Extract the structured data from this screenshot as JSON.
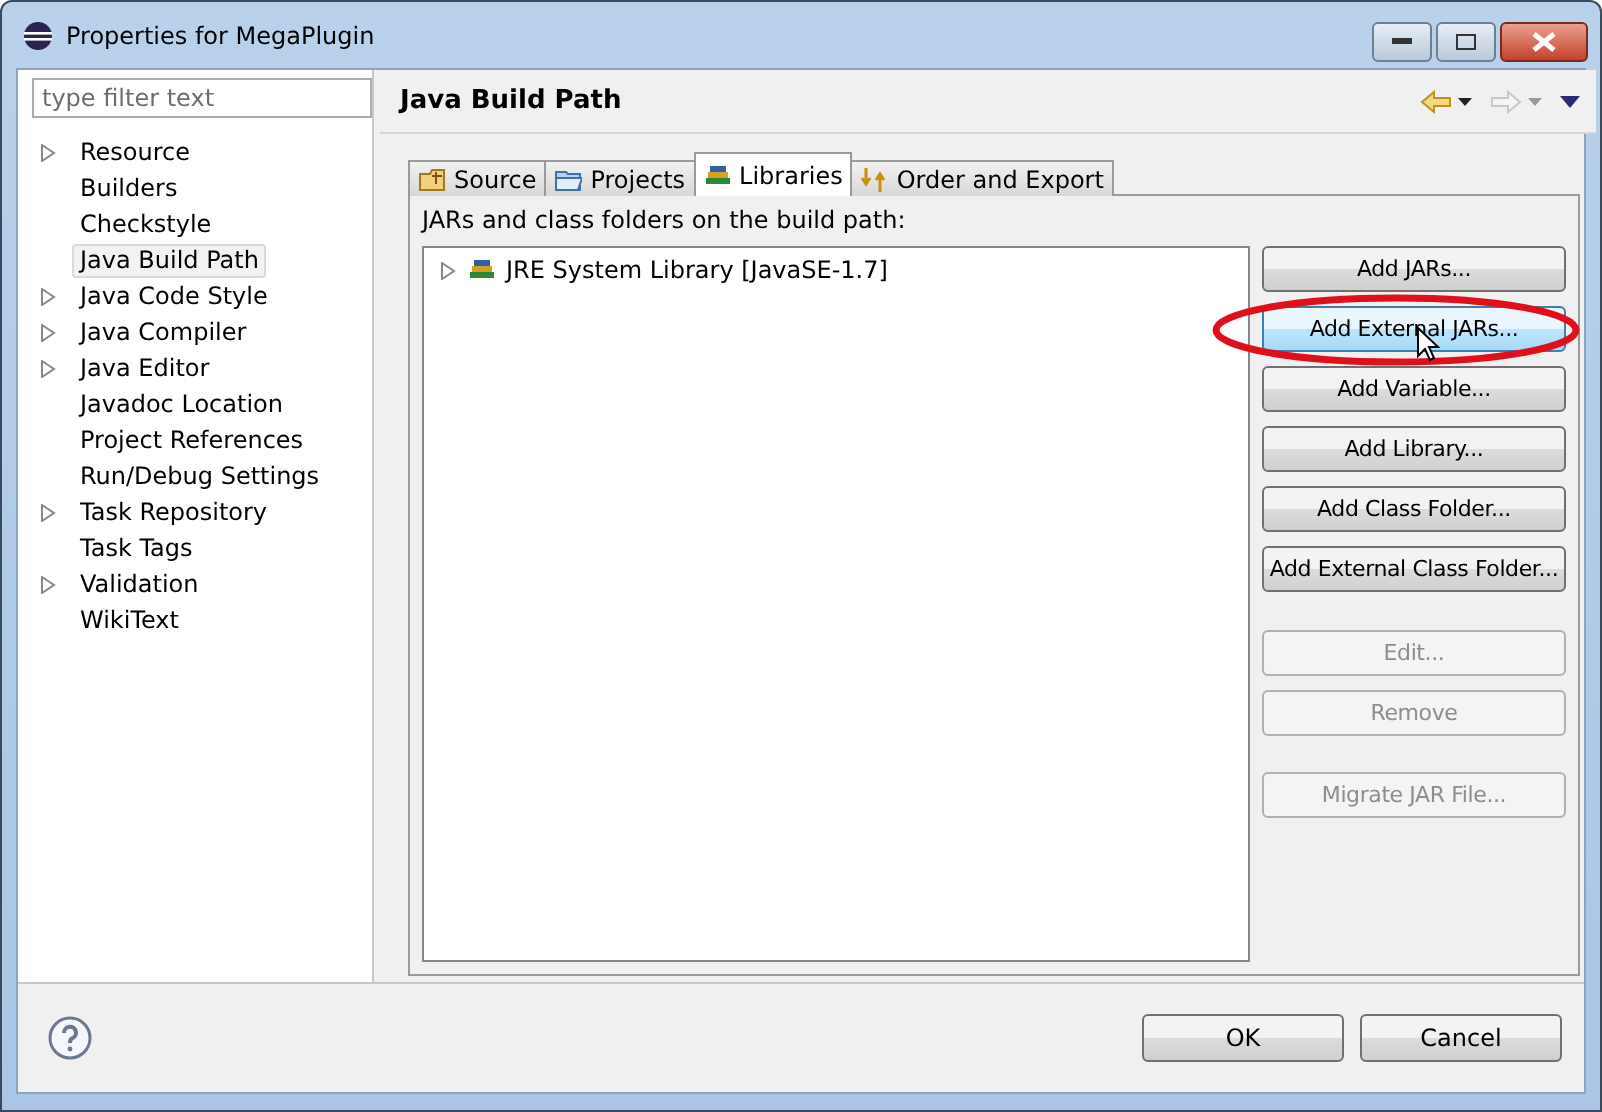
{
  "window": {
    "title": "Properties for MegaPlugin"
  },
  "filter": {
    "placeholder": "type filter text"
  },
  "tree": [
    {
      "label": "Resource",
      "expandable": true,
      "selected": false
    },
    {
      "label": "Builders",
      "expandable": false,
      "selected": false
    },
    {
      "label": "Checkstyle",
      "expandable": false,
      "selected": false
    },
    {
      "label": "Java Build Path",
      "expandable": false,
      "selected": true
    },
    {
      "label": "Java Code Style",
      "expandable": true,
      "selected": false
    },
    {
      "label": "Java Compiler",
      "expandable": true,
      "selected": false
    },
    {
      "label": "Java Editor",
      "expandable": true,
      "selected": false
    },
    {
      "label": "Javadoc Location",
      "expandable": false,
      "selected": false
    },
    {
      "label": "Project References",
      "expandable": false,
      "selected": false
    },
    {
      "label": "Run/Debug Settings",
      "expandable": false,
      "selected": false
    },
    {
      "label": "Task Repository",
      "expandable": true,
      "selected": false
    },
    {
      "label": "Task Tags",
      "expandable": false,
      "selected": false
    },
    {
      "label": "Validation",
      "expandable": true,
      "selected": false
    },
    {
      "label": "WikiText",
      "expandable": false,
      "selected": false
    }
  ],
  "page_title": "Java Build Path",
  "tabs": [
    {
      "label": "Source",
      "selected": false
    },
    {
      "label": "Projects",
      "selected": false
    },
    {
      "label": "Libraries",
      "selected": true
    },
    {
      "label": "Order and Export",
      "selected": false
    }
  ],
  "list_label": "JARs and class folders on the build path:",
  "libraries": [
    {
      "label": "JRE System Library [JavaSE-1.7]",
      "expanded": false
    }
  ],
  "button_groups": [
    [
      {
        "label": "Add JARs...",
        "disabled": false,
        "hovered": false
      },
      {
        "label": "Add External JARs...",
        "disabled": false,
        "hovered": true
      },
      {
        "label": "Add Variable...",
        "disabled": false,
        "hovered": false
      },
      {
        "label": "Add Library...",
        "disabled": false,
        "hovered": false
      },
      {
        "label": "Add Class Folder...",
        "disabled": false,
        "hovered": false
      },
      {
        "label": "Add External Class Folder...",
        "disabled": false,
        "hovered": false
      }
    ],
    [
      {
        "label": "Edit...",
        "disabled": true,
        "hovered": false
      },
      {
        "label": "Remove",
        "disabled": true,
        "hovered": false
      }
    ],
    [
      {
        "label": "Migrate JAR File...",
        "disabled": true,
        "hovered": false
      }
    ]
  ],
  "dialog_buttons": [
    "OK",
    "Cancel"
  ]
}
